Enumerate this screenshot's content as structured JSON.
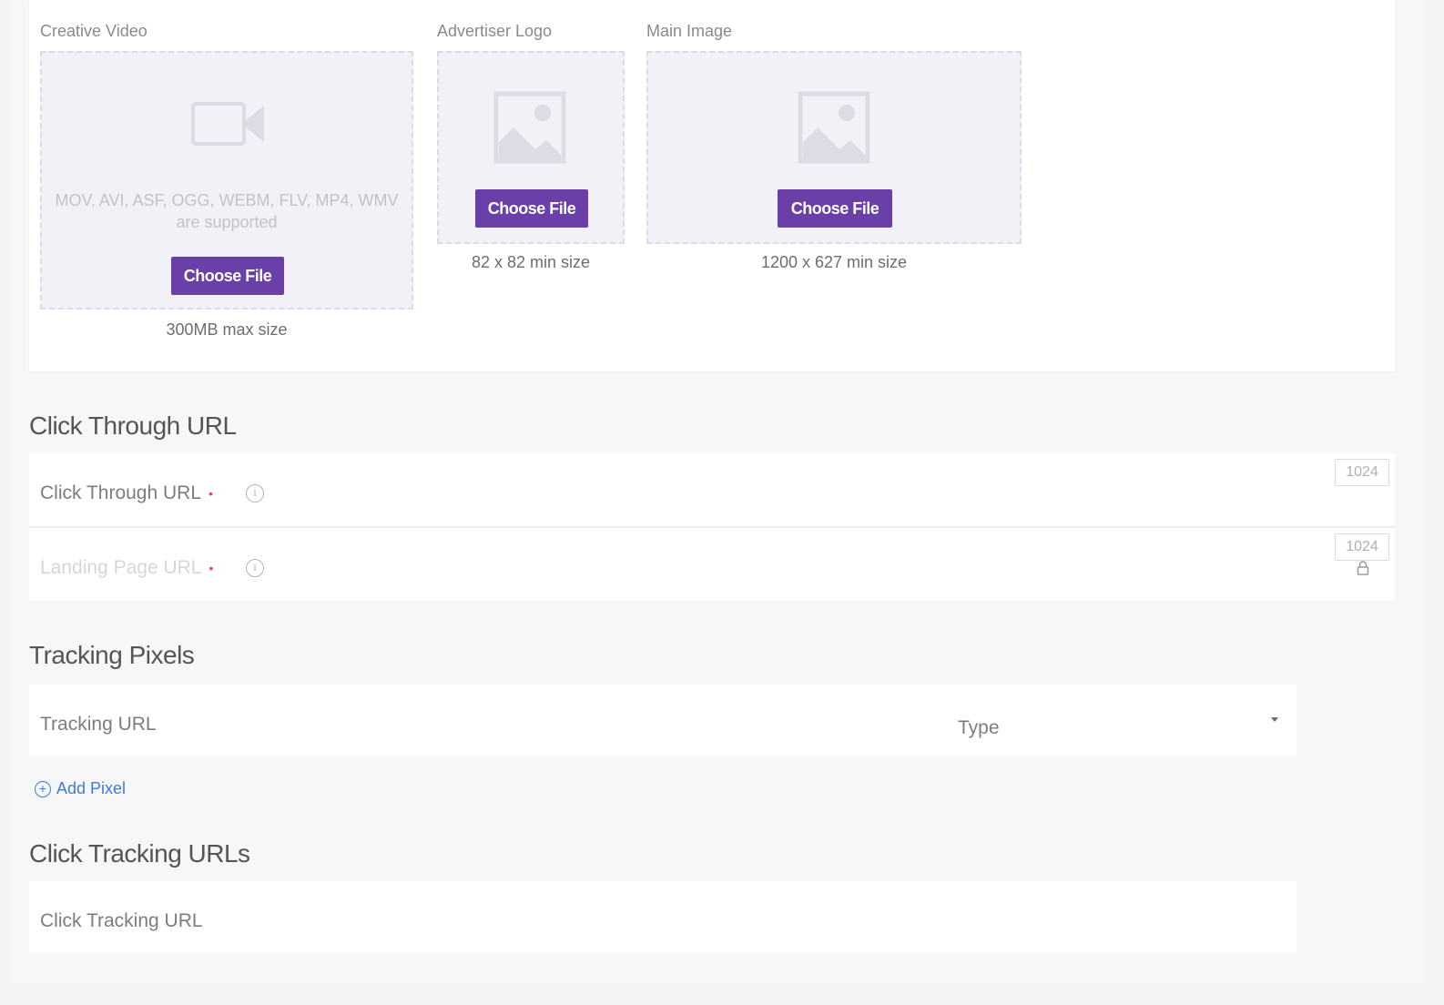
{
  "uploads": {
    "video": {
      "label": "Creative Video",
      "formats": "MOV, AVI, ASF, OGG, WEBM, FLV, MP4, WMV are supported",
      "button": "Choose File",
      "size_note": "300MB max size",
      "icon": "video-camera-icon"
    },
    "logo": {
      "label": "Advertiser Logo",
      "button": "Choose File",
      "size_note": "82 x 82 min size",
      "icon": "image-placeholder-icon"
    },
    "main_image": {
      "label": "Main Image",
      "button": "Choose File",
      "size_note": "1200 x 627 min size",
      "icon": "image-placeholder-icon"
    }
  },
  "click_through": {
    "title": "Click Through URL",
    "fields": [
      {
        "label": "Click Through URL",
        "required_mark": "•",
        "counter": "1024"
      },
      {
        "label": "Landing Page URL",
        "required_mark": "•",
        "counter": "1024",
        "locked": true
      }
    ]
  },
  "tracking_pixels": {
    "title": "Tracking Pixels",
    "url_placeholder": "Tracking URL",
    "type_placeholder": "Type",
    "add_label": "Add Pixel"
  },
  "click_tracking": {
    "title": "Click Tracking URLs",
    "url_placeholder": "Click Tracking URL"
  },
  "colors": {
    "accent": "#6a3fa8",
    "link": "#3d7ae6",
    "required": "#e2485f",
    "dropzone_bg": "#f3f1f8"
  }
}
